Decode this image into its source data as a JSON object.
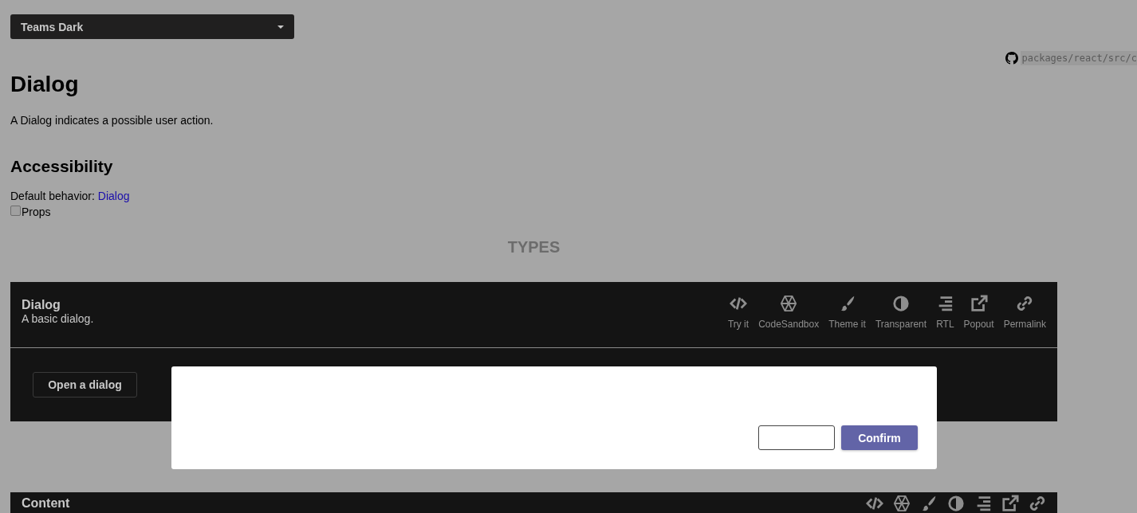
{
  "theme_dropdown": {
    "value": "Teams Dark"
  },
  "source_link": {
    "path": "packages/react/src/c"
  },
  "page": {
    "title": "Dialog",
    "description": "A Dialog indicates a possible user action."
  },
  "accessibility": {
    "heading": "Accessibility",
    "behavior_label": "Default behavior:",
    "behavior_link": "Dialog",
    "props_checkbox": {
      "label": "Props",
      "checked": false
    }
  },
  "section_heading": "TYPES",
  "examples": [
    {
      "title": "Dialog",
      "description": "A basic dialog.",
      "actions": [
        "Try it",
        "CodeSandbox",
        "Theme it",
        "Transparent",
        "RTL",
        "Popout",
        "Permalink"
      ],
      "button": "Open a dialog"
    },
    {
      "title": "Content"
    }
  ],
  "dialog": {
    "confirm_button": "Confirm"
  }
}
